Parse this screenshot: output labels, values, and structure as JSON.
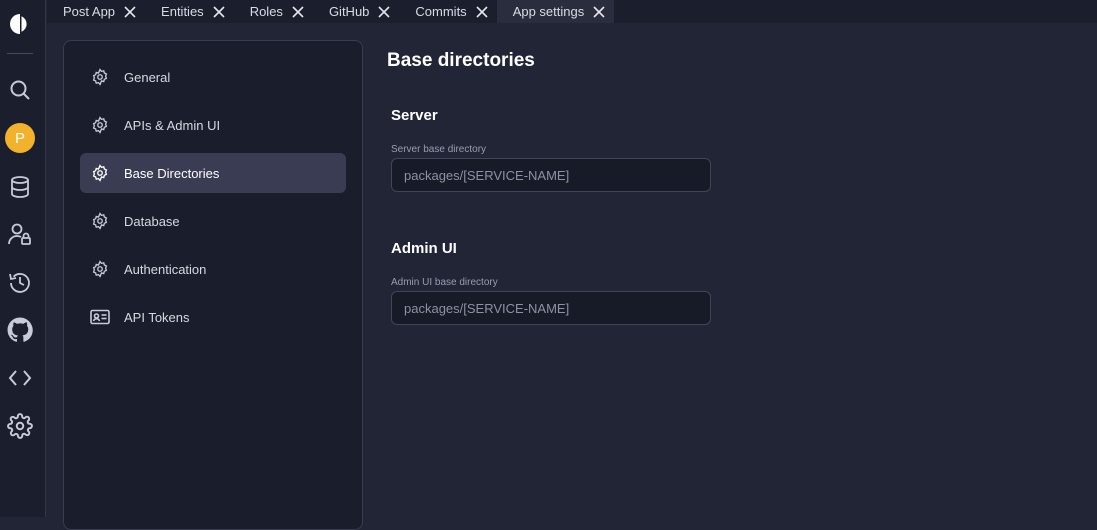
{
  "rail": {
    "avatar_letter": "P",
    "icons": [
      "logo-icon",
      "search-icon",
      "avatar",
      "database-icon",
      "user-lock-icon",
      "history-icon",
      "github-icon",
      "code-icon",
      "gear-icon"
    ]
  },
  "tabs": [
    {
      "label": "Post App",
      "active": false
    },
    {
      "label": "Entities",
      "active": false
    },
    {
      "label": "Roles",
      "active": false
    },
    {
      "label": "GitHub",
      "active": false
    },
    {
      "label": "Commits",
      "active": false
    },
    {
      "label": "App settings",
      "active": true
    }
  ],
  "settings_nav": {
    "items": [
      {
        "label": "General",
        "icon": "gear-icon"
      },
      {
        "label": "APIs & Admin UI",
        "icon": "gear-icon"
      },
      {
        "label": "Base Directories",
        "icon": "gear-icon",
        "active": true
      },
      {
        "label": "Database",
        "icon": "gear-icon"
      },
      {
        "label": "Authentication",
        "icon": "gear-icon"
      },
      {
        "label": "API Tokens",
        "icon": "id-card-icon"
      }
    ]
  },
  "main": {
    "title": "Base directories",
    "server": {
      "title": "Server",
      "label": "Server base directory",
      "placeholder": "packages/[SERVICE-NAME]"
    },
    "admin": {
      "title": "Admin UI",
      "label": "Admin UI base directory",
      "placeholder": "packages/[SERVICE-NAME]"
    }
  },
  "colors": {
    "background": "#222536",
    "rail": "#1b1e2c",
    "active_nav": "#393c53",
    "avatar": "#f3b22c"
  }
}
